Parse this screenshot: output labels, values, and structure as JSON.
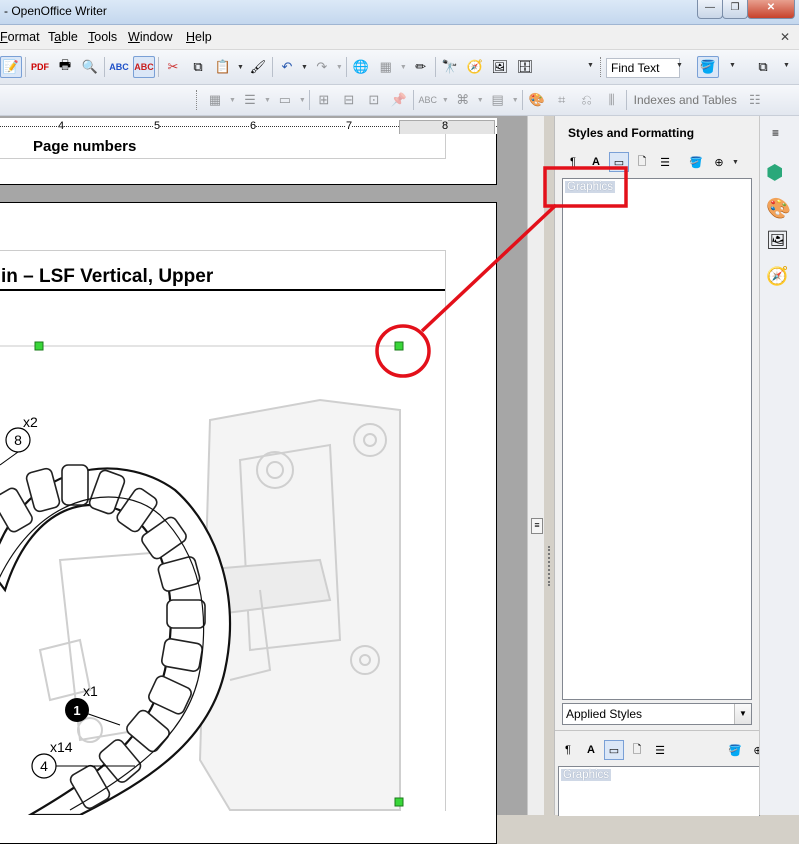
{
  "window": {
    "title": "- OpenOffice Writer",
    "minimize": "—",
    "restore": "❐",
    "close": "✕"
  },
  "menu": {
    "items": [
      {
        "label": "Format",
        "u": "F"
      },
      {
        "label": "Table",
        "u": "a"
      },
      {
        "label": "Tools",
        "u": "T"
      },
      {
        "label": "Window",
        "u": "W"
      },
      {
        "label": "Help",
        "u": "H"
      }
    ],
    "close_doc": "✕"
  },
  "toolbar": {
    "find_text_label": "Find Text",
    "indexes_label": "Indexes and Tables"
  },
  "ruler": {
    "marks": [
      "4",
      "5",
      "6",
      "7",
      "8"
    ]
  },
  "document": {
    "header_text": "Page numbers",
    "heading_text": "in – LSF Vertical, Upper",
    "callouts": [
      {
        "num": "8",
        "qty": "x2"
      },
      {
        "num": "1",
        "qty": "x1"
      },
      {
        "num": "4",
        "qty": "x14"
      }
    ]
  },
  "styles_panel": {
    "title": "Styles and Formatting",
    "selected_style": "Graphics",
    "filter": "Applied Styles",
    "bottom_selected_style": "Graphics"
  },
  "colors": {
    "annotation_red": "#e3101a",
    "selection_handle": "#39d639",
    "selection_blue": "#cfd8e6"
  }
}
